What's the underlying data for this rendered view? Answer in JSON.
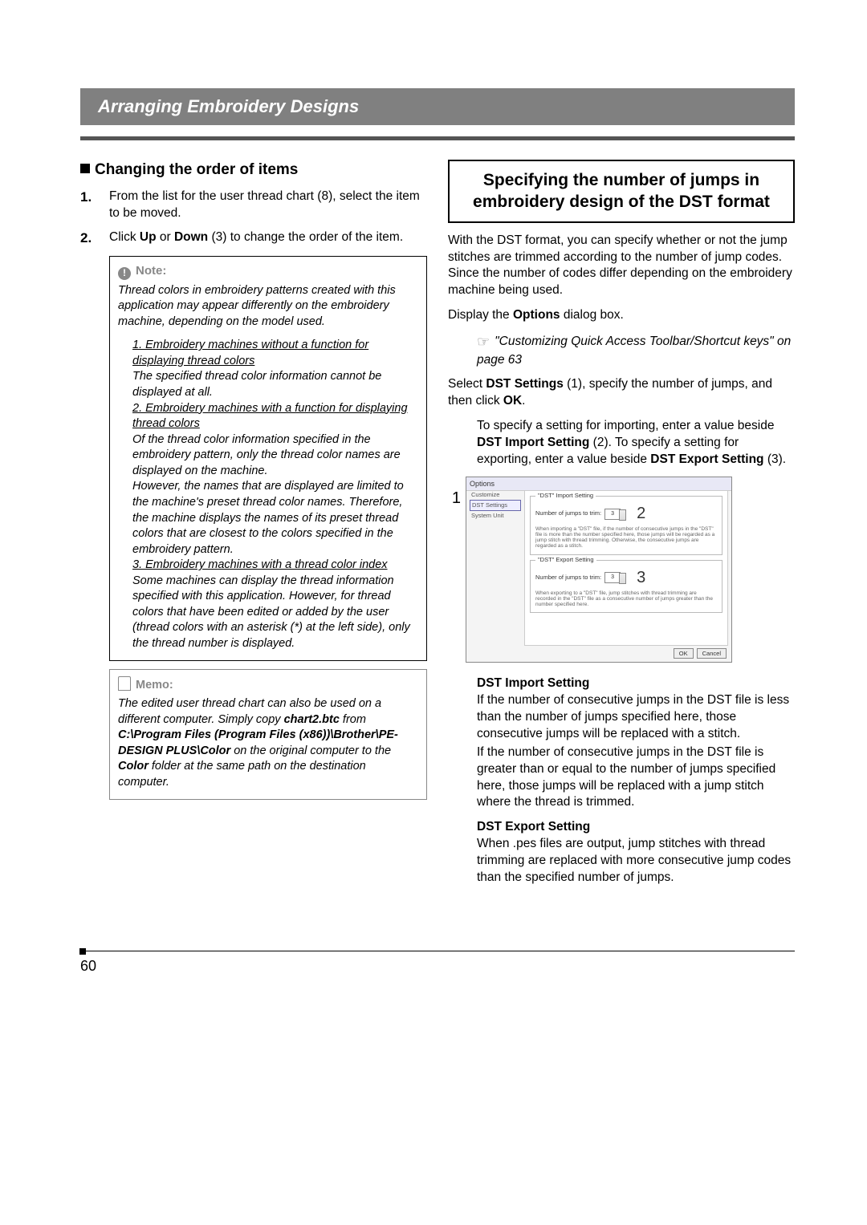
{
  "header": "Arranging Embroidery Designs",
  "left": {
    "heading": "Changing the order of items",
    "step1_num": "1.",
    "step1_text_a": "From the list for the user thread chart (8), select the item to be moved.",
    "step2_num": "2.",
    "step2_text_a": "Click ",
    "step2_bold1": "Up",
    "step2_mid": " or ",
    "step2_bold2": "Down",
    "step2_text_b": " (3) to change the order of the item.",
    "note_title": "Note:",
    "note_intro": "Thread colors in embroidery patterns created with this application may appear differently on the embroidery machine, depending on the model used.",
    "note_u1": "1. Embroidery machines without a function for displaying thread colors",
    "note_t1": "The specified thread color information cannot be displayed at all.",
    "note_u2": "2. Embroidery machines with a function for displaying thread colors",
    "note_t2": "Of the thread color information specified in the embroidery pattern, only the thread color names are displayed on the machine.\nHowever, the names that are displayed are limited to the machine's preset thread color names. Therefore, the machine displays the names of its preset thread colors that are closest to the colors specified in the embroidery pattern.",
    "note_u3": "3. Embroidery machines with a thread color index",
    "note_t3": "Some machines can display the thread information specified with this application. However, for thread colors that have been edited or added by the user (thread colors with an asterisk (*) at the left side), only the thread number is displayed.",
    "memo_title": "Memo:",
    "memo_a": "The edited user thread chart can also be used on a different computer. Simply copy ",
    "memo_file": "chart2.btc",
    "memo_b": " from",
    "memo_path": "C:\\Program Files (Program Files (x86))\\Brother\\PE-DESIGN PLUS\\Color",
    "memo_c": " on the original computer to the ",
    "memo_color": "Color",
    "memo_d": " folder at the same path on the destination computer."
  },
  "right": {
    "title": "Specifying the number of jumps in embroidery design of the DST format",
    "p1": "With the DST format, you can specify whether or not the jump stitches are trimmed according to the number of jump codes. Since the number of codes differ depending on the embroidery machine being used.",
    "p2_a": "Display the ",
    "p2_b": "Options",
    "p2_c": " dialog box.",
    "ref": "\"Customizing Quick Access Toolbar/Shortcut keys\" on page 63",
    "p3_a": "Select ",
    "p3_b": "DST Settings",
    "p3_c": " (1), specify the number of jumps, and then click ",
    "p3_d": "OK",
    "p3_e": ".",
    "p4_a": "To specify a setting for importing, enter a value beside ",
    "p4_b": "DST Import Setting",
    "p4_c": " (2). To specify a setting for exporting, enter a value beside ",
    "p4_d": "DST Export Setting",
    "p4_e": " (3).",
    "shot": {
      "title": "Options",
      "side_customize": "Customize",
      "side_dst": "DST Settings",
      "side_sys": "System Unit",
      "group1_title": "\"DST\" Import Setting",
      "group2_title": "\"DST\" Export Setting",
      "field_label": "Number of jumps to trim:",
      "value": "3",
      "desc1": "When importing a \"DST\" file, if the number of consecutive jumps in the \"DST\" file is more than the number specified here, those jumps will be regarded as a jump stitch with thread trimming. Otherwise, the consecutive jumps are regarded as a stitch.",
      "desc2": "When exporting to a \"DST\" file, jump stitches with thread trimming are recorded in the \"DST\" file as a consecutive number of jumps greater than the number specified here.",
      "ok": "OK",
      "cancel": "Cancel"
    },
    "c1": "1",
    "c2": "2",
    "c3": "3",
    "imp_h": "DST Import Setting",
    "imp_p1": "If the number of consecutive jumps in the DST file is less than the number of jumps specified here, those consecutive jumps will be replaced with a stitch.",
    "imp_p2": "If the number of consecutive jumps in the DST file is greater than or equal to the number of jumps specified here, those jumps will be replaced with a jump stitch where the thread is trimmed.",
    "exp_h": "DST Export Setting",
    "exp_p": "When .pes files are output, jump stitches with thread trimming are replaced with more consecutive jump codes than the specified number of jumps."
  },
  "page_number": "60"
}
